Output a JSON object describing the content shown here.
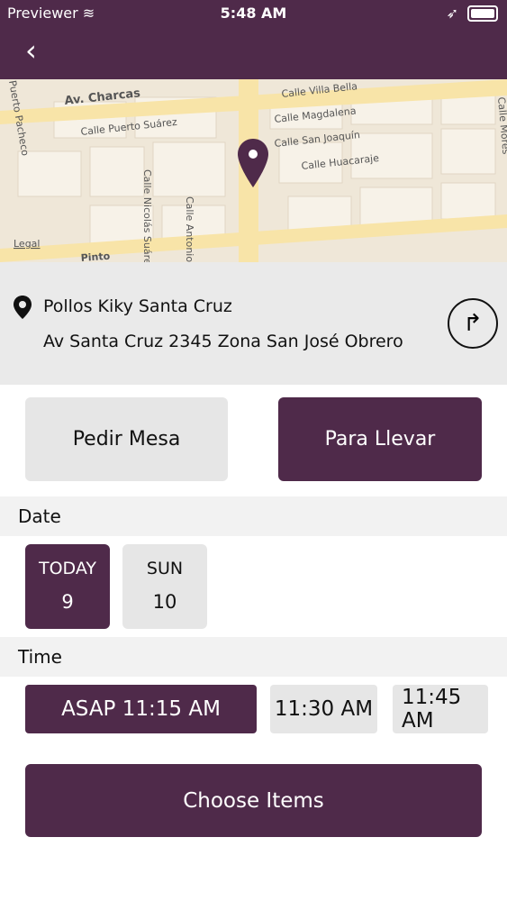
{
  "status_bar": {
    "carrier": "Previewer",
    "time": "5:48 AM"
  },
  "header": {
    "back_icon": "chevron-left"
  },
  "map": {
    "streets": [
      "Av. Charcas",
      "Calle Villa Bella",
      "Calle Magdalena",
      "Calle Puerto Suárez",
      "Calle San Joaquín",
      "Calle Huacaraje",
      "Calle Nicolás Suárez",
      "Calle Antonio",
      "Puerto Pacheco",
      "Calle Mores",
      "Legal",
      "Pinto"
    ]
  },
  "location": {
    "name": "Pollos Kiky Santa Cruz",
    "address": "Av Santa Cruz 2345 Zona San José Obrero"
  },
  "order_type": {
    "mesa": "Pedir Mesa",
    "llevar": "Para Llevar"
  },
  "date": {
    "label": "Date",
    "days": [
      {
        "name": "TODAY",
        "num": "9"
      },
      {
        "name": "SUN",
        "num": "10"
      }
    ]
  },
  "time": {
    "label": "Time",
    "options": [
      "ASAP 11:15 AM",
      "11:30 AM",
      "11:45 AM"
    ]
  },
  "actions": {
    "choose_items": "Choose Items"
  },
  "colors": {
    "primary": "#4f2a4a",
    "secondary": "#e6e6e6"
  }
}
